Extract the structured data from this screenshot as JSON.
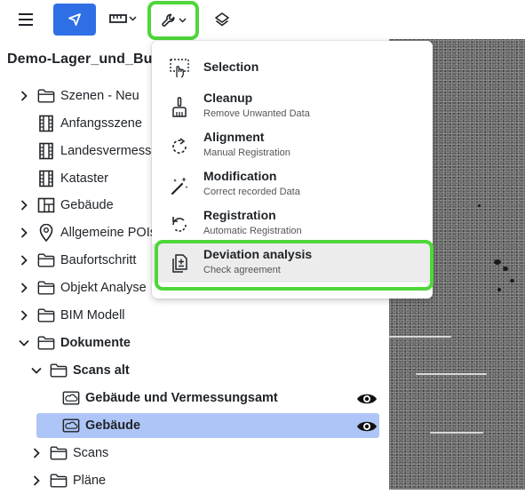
{
  "toolbar": {
    "menu_icon": "hamburger-icon",
    "select_icon": "cursor-arrow-icon",
    "measure_icon": "ruler-icon",
    "tools_icon": "wrench-icon",
    "layers_icon": "layers-icon",
    "accent_color": "#2f6fe6",
    "highlight_color": "#4fd63a"
  },
  "project": {
    "title": "Demo-Lager_und_Bue"
  },
  "tree": [
    {
      "label": "Szenen - Neu",
      "icon": "folder-icon",
      "arrow": "right"
    },
    {
      "label": "Anfangsszene",
      "icon": "film-icon",
      "arrow": ""
    },
    {
      "label": "Landesvermess",
      "icon": "film-icon",
      "arrow": ""
    },
    {
      "label": "Kataster",
      "icon": "film-icon",
      "arrow": ""
    },
    {
      "label": "Gebäude",
      "icon": "floorplan-icon",
      "arrow": "right"
    },
    {
      "label": "Allgemeine POIs",
      "icon": "map-pin-icon",
      "arrow": "right"
    },
    {
      "label": "Baufortschritt",
      "icon": "folder-icon",
      "arrow": "right"
    },
    {
      "label": "Objekt Analyse",
      "icon": "folder-icon",
      "arrow": "right"
    },
    {
      "label": "BIM Modell",
      "icon": "folder-icon",
      "arrow": "right"
    },
    {
      "label": "Dokumente",
      "icon": "folder-icon",
      "arrow": "down"
    },
    {
      "label": "Scans alt",
      "icon": "folder-icon",
      "arrow": "down"
    },
    {
      "label": "Gebäude und Vermessungsamt",
      "icon": "cloud-scan-icon",
      "arrow": ""
    },
    {
      "label": "Gebäude",
      "icon": "cloud-scan-icon",
      "arrow": ""
    },
    {
      "label": "Scans",
      "icon": "folder-icon",
      "arrow": "right"
    },
    {
      "label": "Pläne",
      "icon": "folder-icon",
      "arrow": "right"
    }
  ],
  "menu": {
    "items": [
      {
        "title": "Selection",
        "subtitle": "",
        "icon": "hand-select-icon"
      },
      {
        "title": "Cleanup",
        "subtitle": "Remove Unwanted Data",
        "icon": "broom-icon"
      },
      {
        "title": "Alignment",
        "subtitle": "Manual Registration",
        "icon": "rotate-icon"
      },
      {
        "title": "Modification",
        "subtitle": "Correct recorded Data",
        "icon": "magic-wand-icon"
      },
      {
        "title": "Registration",
        "subtitle": "Automatic Registration",
        "icon": "refresh-icon"
      },
      {
        "title": "Deviation analysis",
        "subtitle": "Check agreement",
        "icon": "document-compare-icon"
      }
    ]
  }
}
